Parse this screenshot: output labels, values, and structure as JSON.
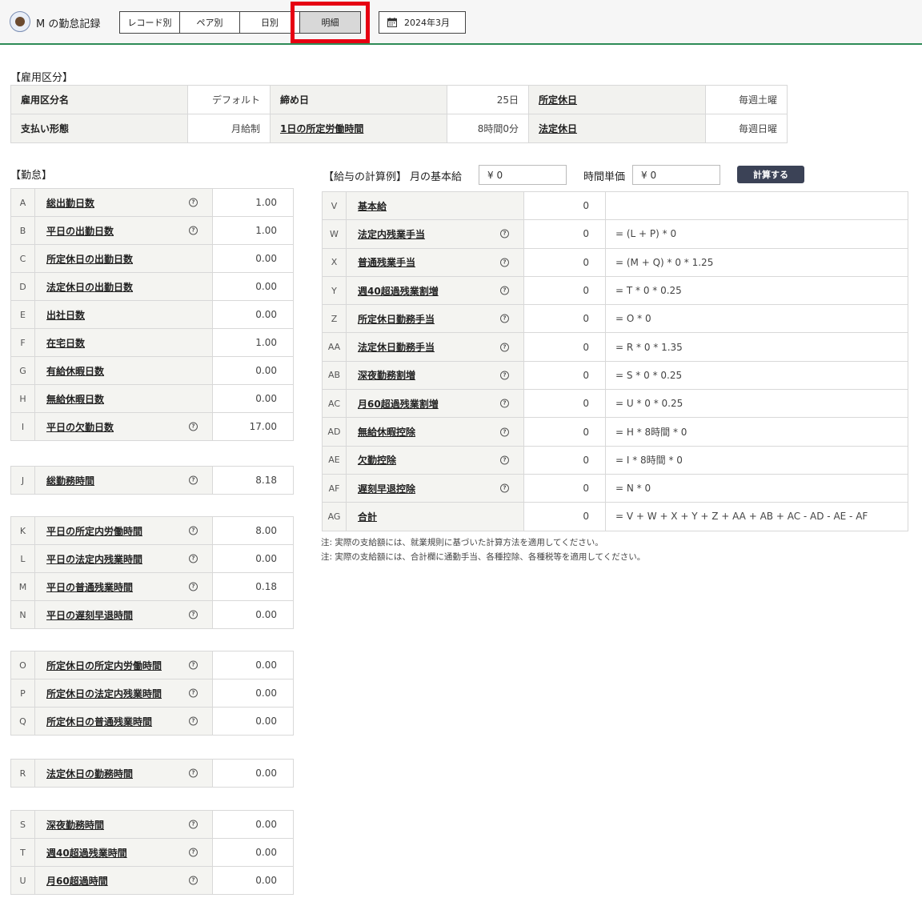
{
  "header": {
    "app_title": "M の勤怠記録",
    "tabs": [
      {
        "label": "レコード別",
        "active": false
      },
      {
        "label": "ペア別",
        "active": false
      },
      {
        "label": "日別",
        "active": false
      },
      {
        "label": "明細",
        "active": true
      }
    ],
    "month": "2024年3月",
    "accent_color": "#2e8b57",
    "highlight_color": "#e60012"
  },
  "employment": {
    "section_label": "【雇用区分】",
    "rows": [
      [
        {
          "key": "雇用区分名",
          "value": "デフォルト",
          "link": false
        },
        {
          "key": "締め日",
          "value": "25日",
          "link": false
        },
        {
          "key": "所定休日",
          "value": "毎週土曜",
          "link": true
        }
      ],
      [
        {
          "key": "支払い形態",
          "value": "月給制",
          "link": false
        },
        {
          "key": "1日の所定労働時間",
          "value": "8時間0分",
          "link": true
        },
        {
          "key": "法定休日",
          "value": "毎週日曜",
          "link": true
        }
      ]
    ]
  },
  "attendance": {
    "section_label": "【勤怠】",
    "groups": [
      [
        {
          "code": "A",
          "name": "総出勤日数",
          "help": true,
          "value": "1.00"
        },
        {
          "code": "B",
          "name": "平日の出勤日数",
          "help": true,
          "value": "1.00"
        },
        {
          "code": "C",
          "name": "所定休日の出勤日数",
          "help": false,
          "value": "0.00"
        },
        {
          "code": "D",
          "name": "法定休日の出勤日数",
          "help": false,
          "value": "0.00"
        },
        {
          "code": "E",
          "name": "出社日数",
          "help": false,
          "value": "0.00"
        },
        {
          "code": "F",
          "name": "在宅日数",
          "help": false,
          "value": "1.00"
        },
        {
          "code": "G",
          "name": "有給休暇日数",
          "help": false,
          "value": "0.00"
        },
        {
          "code": "H",
          "name": "無給休暇日数",
          "help": false,
          "value": "0.00"
        },
        {
          "code": "I",
          "name": "平日の欠勤日数",
          "help": true,
          "value": "17.00"
        }
      ],
      [
        {
          "code": "J",
          "name": "総勤務時間",
          "help": true,
          "value": "8.18"
        }
      ],
      [
        {
          "code": "K",
          "name": "平日の所定内労働時間",
          "help": true,
          "value": "8.00"
        },
        {
          "code": "L",
          "name": "平日の法定内残業時間",
          "help": true,
          "value": "0.00"
        },
        {
          "code": "M",
          "name": "平日の普通残業時間",
          "help": true,
          "value": "0.18"
        },
        {
          "code": "N",
          "name": "平日の遅刻早退時間",
          "help": true,
          "value": "0.00"
        }
      ],
      [
        {
          "code": "O",
          "name": "所定休日の所定内労働時間",
          "help": true,
          "value": "0.00"
        },
        {
          "code": "P",
          "name": "所定休日の法定内残業時間",
          "help": true,
          "value": "0.00"
        },
        {
          "code": "Q",
          "name": "所定休日の普通残業時間",
          "help": true,
          "value": "0.00"
        }
      ],
      [
        {
          "code": "R",
          "name": "法定休日の勤務時間",
          "help": true,
          "value": "0.00"
        }
      ],
      [
        {
          "code": "S",
          "name": "深夜勤務時間",
          "help": true,
          "value": "0.00"
        },
        {
          "code": "T",
          "name": "週40超過残業時間",
          "help": true,
          "value": "0.00"
        },
        {
          "code": "U",
          "name": "月60超過時間",
          "help": true,
          "value": "0.00"
        }
      ]
    ]
  },
  "salary": {
    "section_label": "【給与の計算例】",
    "base_salary_label": "月の基本給",
    "base_salary_value": "¥ 0",
    "hourly_label": "時間単価",
    "hourly_value": "¥ 0",
    "calc_button": "計算する",
    "rows": [
      {
        "code": "V",
        "name": "基本給",
        "help": false,
        "amount": "0",
        "formula": ""
      },
      {
        "code": "W",
        "name": "法定内残業手当",
        "help": true,
        "amount": "0",
        "formula": "= (L + P) * 0"
      },
      {
        "code": "X",
        "name": "普通残業手当",
        "help": true,
        "amount": "0",
        "formula": "= (M + Q) * 0 * 1.25"
      },
      {
        "code": "Y",
        "name": "週40超過残業割増",
        "help": true,
        "amount": "0",
        "formula": "= T * 0 * 0.25"
      },
      {
        "code": "Z",
        "name": "所定休日勤務手当",
        "help": true,
        "amount": "0",
        "formula": "= O * 0"
      },
      {
        "code": "AA",
        "name": "法定休日勤務手当",
        "help": true,
        "amount": "0",
        "formula": "= R * 0 * 1.35"
      },
      {
        "code": "AB",
        "name": "深夜勤務割増",
        "help": true,
        "amount": "0",
        "formula": "= S * 0 * 0.25"
      },
      {
        "code": "AC",
        "name": "月60超過残業割増",
        "help": true,
        "amount": "0",
        "formula": "= U * 0 * 0.25"
      },
      {
        "code": "AD",
        "name": "無給休暇控除",
        "help": true,
        "amount": "0",
        "formula": "= H * 8時間 * 0"
      },
      {
        "code": "AE",
        "name": "欠勤控除",
        "help": true,
        "amount": "0",
        "formula": "= I * 8時間 * 0"
      },
      {
        "code": "AF",
        "name": "遅刻早退控除",
        "help": true,
        "amount": "0",
        "formula": "= N * 0"
      },
      {
        "code": "AG",
        "name": "合計",
        "help": false,
        "amount": "0",
        "formula": "= V + W + X + Y + Z + AA + AB + AC - AD - AE - AF"
      }
    ],
    "notes": [
      "注: 実際の支給額には、就業規則に基づいた計算方法を適用してください。",
      "注: 実際の支給額には、合計欄に通勤手当、各種控除、各種税等を適用してください。"
    ]
  }
}
